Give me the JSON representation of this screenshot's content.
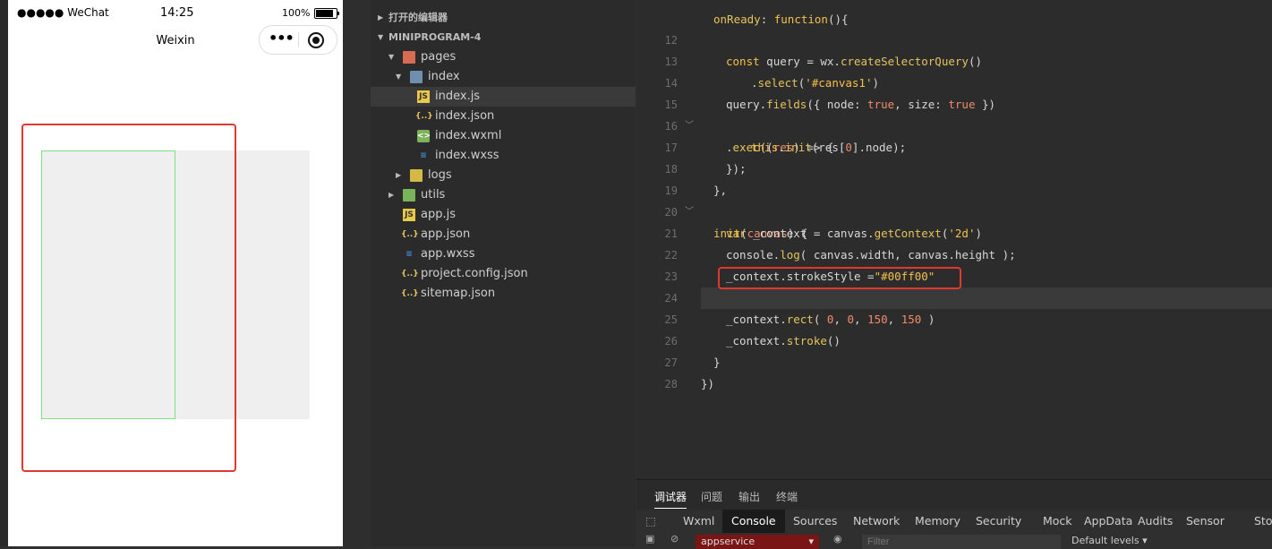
{
  "status_bar": {
    "carrier": "●●●●● WeChat",
    "time": "14:25",
    "battery": "100%"
  },
  "nav_bar": {
    "title": "Weixin"
  },
  "sidebar": {
    "section_open_editors": "打开的编辑器",
    "section_project": "MINIPROGRAM-4",
    "items": [
      {
        "label": "pages"
      },
      {
        "label": "index"
      },
      {
        "label": "index.js"
      },
      {
        "label": "index.json"
      },
      {
        "label": "index.wxml"
      },
      {
        "label": "index.wxss"
      },
      {
        "label": "logs"
      },
      {
        "label": "utils"
      },
      {
        "label": "app.js"
      },
      {
        "label": "app.json"
      },
      {
        "label": "app.wxss"
      },
      {
        "label": "project.config.json"
      },
      {
        "label": "sitemap.json"
      }
    ]
  },
  "editor": {
    "line_numbers": [
      "12",
      "13",
      "14",
      "15",
      "16",
      "17",
      "18",
      "19",
      "20",
      "21",
      "22",
      "23",
      "24",
      "25",
      "26",
      "27",
      "28"
    ]
  },
  "debugger": {
    "tabs": [
      "调试器",
      "问题",
      "输出",
      "终端"
    ],
    "devtools_tabs": [
      "Wxml",
      "Console",
      "Sources",
      "Network",
      "Memory",
      "Security",
      "Mock",
      "AppData",
      "Audits",
      "Sensor",
      "Sto"
    ],
    "context": "appservice",
    "filter_placeholder": "Filter",
    "levels": "Default levels ▾"
  }
}
